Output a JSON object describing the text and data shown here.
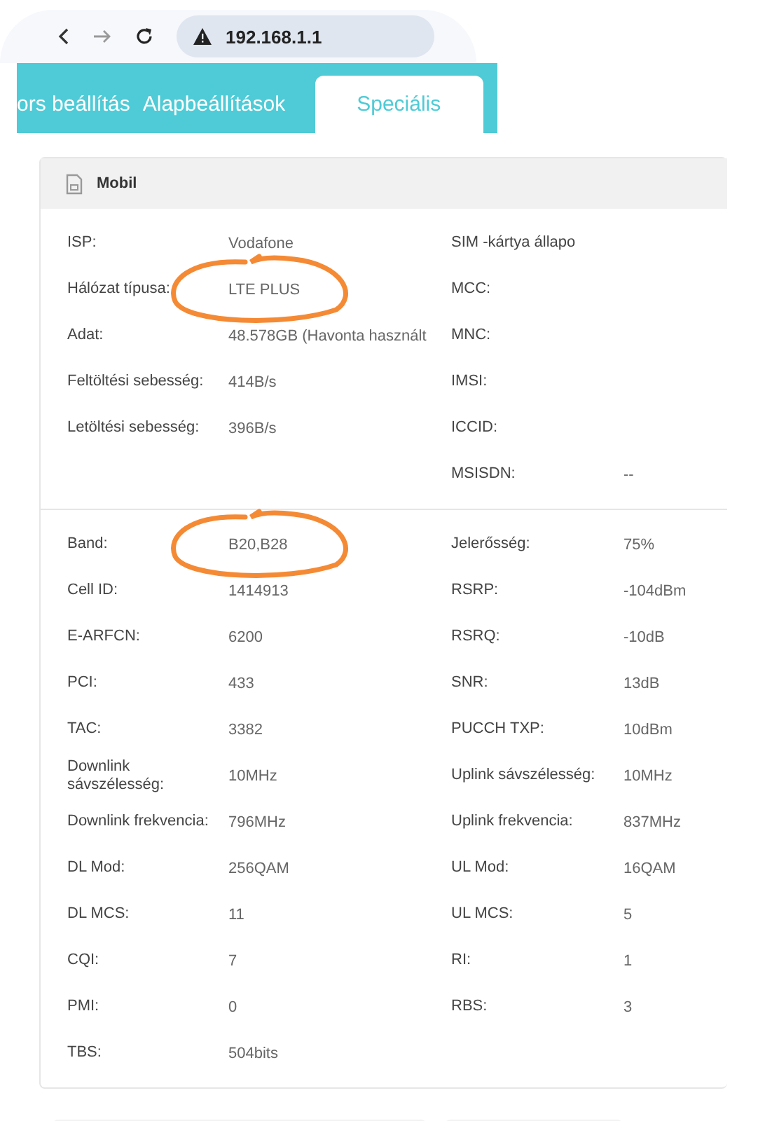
{
  "browser": {
    "url": "192.168.1.1"
  },
  "tabs": [
    {
      "label": "ors beállítás",
      "selected": false
    },
    {
      "label": "Alapbeállítások",
      "selected": false
    },
    {
      "label": "Speciális",
      "selected": true
    }
  ],
  "card": {
    "title": "Mobil",
    "sections": [
      {
        "rows": [
          {
            "left": {
              "label": "ISP:",
              "value": "Vodafone"
            },
            "right": {
              "label": "SIM -kártya állapo"
            }
          },
          {
            "left": {
              "label": "Hálózat típusa:",
              "value": "LTE PLUS",
              "circled": true
            },
            "right": {
              "label": "MCC:"
            }
          },
          {
            "left": {
              "label": "Adat:",
              "value": "48.578GB (Havonta használt"
            },
            "right": {
              "label": "MNC:"
            }
          },
          {
            "left": {
              "label": "Feltöltési sebesség:",
              "value": "414B/s"
            },
            "right": {
              "label": "IMSI:"
            }
          },
          {
            "left": {
              "label": "Letöltési sebesség:",
              "value": "396B/s"
            },
            "right": {
              "label": "ICCID:"
            }
          },
          {
            "right": {
              "label": "MSISDN:",
              "value": "--"
            }
          }
        ]
      },
      {
        "rows": [
          {
            "left": {
              "label": "Band:",
              "value": "B20,B28",
              "circled": true
            },
            "right": {
              "label": "Jelerősség:",
              "value": "75%"
            }
          },
          {
            "left": {
              "label": "Cell ID:",
              "value": "1414913"
            },
            "right": {
              "label": "RSRP:",
              "value": "-104dBm"
            }
          },
          {
            "left": {
              "label": "E-ARFCN:",
              "value": "6200"
            },
            "right": {
              "label": "RSRQ:",
              "value": "-10dB"
            }
          },
          {
            "left": {
              "label": "PCI:",
              "value": "433"
            },
            "right": {
              "label": "SNR:",
              "value": "13dB"
            }
          },
          {
            "left": {
              "label": "TAC:",
              "value": "3382"
            },
            "right": {
              "label": "PUCCH TXP:",
              "value": "10dBm"
            }
          },
          {
            "left": {
              "label": "Downlink sávszélesség:",
              "value": "10MHz"
            },
            "right": {
              "label": "Uplink sávszélesség:",
              "value": "10MHz"
            }
          },
          {
            "left": {
              "label": "Downlink frekvencia:",
              "value": "796MHz"
            },
            "right": {
              "label": "Uplink frekvencia:",
              "value": "837MHz"
            }
          },
          {
            "left": {
              "label": "DL Mod:",
              "value": "256QAM"
            },
            "right": {
              "label": "UL Mod:",
              "value": "16QAM"
            }
          },
          {
            "left": {
              "label": "DL MCS:",
              "value": "11"
            },
            "right": {
              "label": "UL MCS:",
              "value": "5"
            }
          },
          {
            "left": {
              "label": "CQI:",
              "value": "7"
            },
            "right": {
              "label": "RI:",
              "value": "1"
            }
          },
          {
            "left": {
              "label": "PMI:",
              "value": "0"
            },
            "right": {
              "label": "RBS:",
              "value": "3"
            }
          },
          {
            "left": {
              "label": "TBS:",
              "value": "504bits"
            }
          }
        ]
      }
    ]
  }
}
